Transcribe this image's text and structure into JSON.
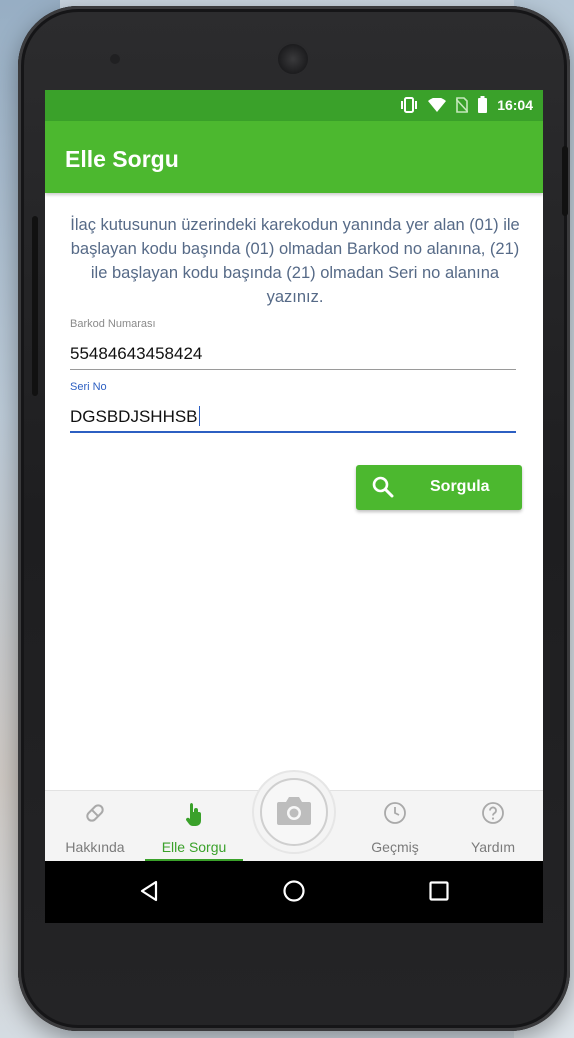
{
  "status_bar": {
    "time": "16:04",
    "icons": [
      "vibrate-icon",
      "wifi-icon",
      "no-sim-icon",
      "battery-icon"
    ]
  },
  "app_bar": {
    "title": "Elle Sorgu"
  },
  "instructions": "İlaç kutusunun üzerindeki karekodun yanında yer alan (01) ile başlayan kodu başında (01) olmadan Barkod no alanına, (21) ile başlayan kodu başında (21) olmadan Seri no alanına yazınız.",
  "form": {
    "barcode": {
      "label": "Barkod Numarası",
      "value": "55484643458424"
    },
    "serial": {
      "label": "Seri No",
      "value": "DGSBDJSHHSB"
    },
    "search_button": {
      "label": "Sorgula",
      "icon": "search-icon"
    }
  },
  "bottom_nav": {
    "items": [
      {
        "label": "Hakkında",
        "icon": "pill-icon"
      },
      {
        "label": "Elle Sorgu",
        "icon": "tap-hand-icon",
        "active": true
      },
      {
        "label": "Geçmiş",
        "icon": "clock-icon"
      },
      {
        "label": "Yardım",
        "icon": "help-icon"
      }
    ],
    "center_icon": "camera-icon"
  },
  "colors": {
    "status_bar": "#3aa12a",
    "app_bar": "#4cb82f",
    "accent": "#2c5fc2",
    "instruction_text": "#566a87"
  }
}
